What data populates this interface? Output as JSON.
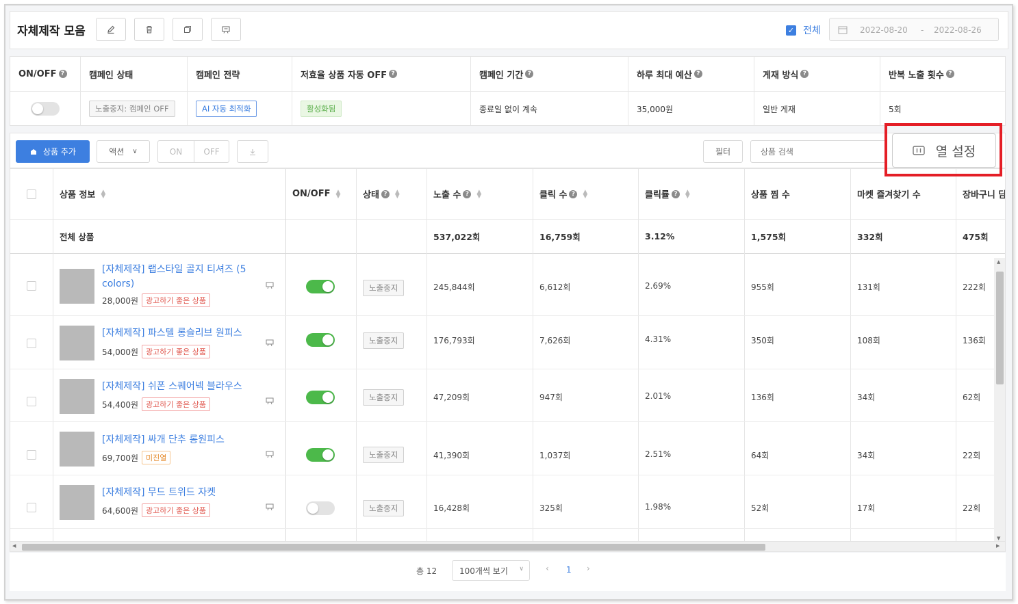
{
  "header": {
    "title": "자체제작 모음",
    "buttons": [
      "edit-icon",
      "trash-icon",
      "copy-icon",
      "ad-icon"
    ],
    "all_label": "전체",
    "date_start": "2022-08-20",
    "date_sep": "-",
    "date_end": "2022-08-26"
  },
  "campaign": {
    "columns": [
      "ON/OFF",
      "캠페인 상태",
      "캠페인 전략",
      "저효율 상품 자동 OFF",
      "캠페인 기간",
      "하루 최대 예산",
      "게재 방식",
      "반복 노출 횟수"
    ],
    "status_tag": "노출중지: 캠페인 OFF",
    "strategy_tag": "AI 자동 최적화",
    "auto_off_tag": "활성화됨",
    "period": "종료일 없이 계속",
    "budget": "35,000원",
    "delivery": "일반 게재",
    "repeat": "5회"
  },
  "toolbar": {
    "add_label": "상품 추가",
    "action_label": "액션",
    "on_label": "ON",
    "off_label": "OFF",
    "filter_label": "필터",
    "search_placeholder": "상품 검색",
    "column_settings_label": "열 설정"
  },
  "table": {
    "headers": [
      "상품 정보",
      "ON/OFF",
      "상태",
      "노출 수",
      "클릭 수",
      "클릭률",
      "상품 찜 수",
      "마켓 즐겨찾기 수",
      "장바구니 담"
    ],
    "total": {
      "label": "전체 상품",
      "impressions": "537,022회",
      "clicks": "16,759회",
      "ctr": "3.12%",
      "likes": "1,575회",
      "favorites": "332회",
      "cart": "475회"
    },
    "rows": [
      {
        "name": "[자체제작] 랩스타일 골지 티셔즈 (5 colors)",
        "price": "28,000원",
        "tag": "광고하기 좋은 상품",
        "tag_color": "#e0584f",
        "on": true,
        "status": "노출중지",
        "impressions": "245,844회",
        "clicks": "6,612회",
        "ctr": "2.69%",
        "likes": "955회",
        "favorites": "131회",
        "cart": "222회"
      },
      {
        "name": "[자체제작] 파스텔 롱슬리브 원피스",
        "price": "54,000원",
        "tag": "광고하기 좋은 상품",
        "tag_color": "#e0584f",
        "on": true,
        "status": "노출중지",
        "impressions": "176,793회",
        "clicks": "7,626회",
        "ctr": "4.31%",
        "likes": "350회",
        "favorites": "108회",
        "cart": "136회"
      },
      {
        "name": "[자체제작] 쉬폰 스퀘어넥 블라우스",
        "price": "54,400원",
        "tag": "광고하기 좋은 상품",
        "tag_color": "#e0584f",
        "on": true,
        "status": "노출중지",
        "impressions": "47,209회",
        "clicks": "947회",
        "ctr": "2.01%",
        "likes": "136회",
        "favorites": "34회",
        "cart": "62회"
      },
      {
        "name": "[자체제작] 싸개 단추 롱원피스",
        "price": "69,700원",
        "tag": "미진열",
        "tag_color": "#e58b2e",
        "on": true,
        "status": "노출중지",
        "impressions": "41,390회",
        "clicks": "1,037회",
        "ctr": "2.51%",
        "likes": "64회",
        "favorites": "34회",
        "cart": "22회"
      },
      {
        "name": "[자체제작] 무드 트위드 자켓",
        "price": "64,600원",
        "tag": "광고하기 좋은 상품",
        "tag_color": "#e0584f",
        "on": false,
        "status": "노출중지",
        "impressions": "16,428회",
        "clicks": "325회",
        "ctr": "1.98%",
        "likes": "52회",
        "favorites": "17회",
        "cart": "22회"
      }
    ]
  },
  "footer": {
    "total": "총 12",
    "per_page": "100개씩 보기",
    "page": "1"
  }
}
